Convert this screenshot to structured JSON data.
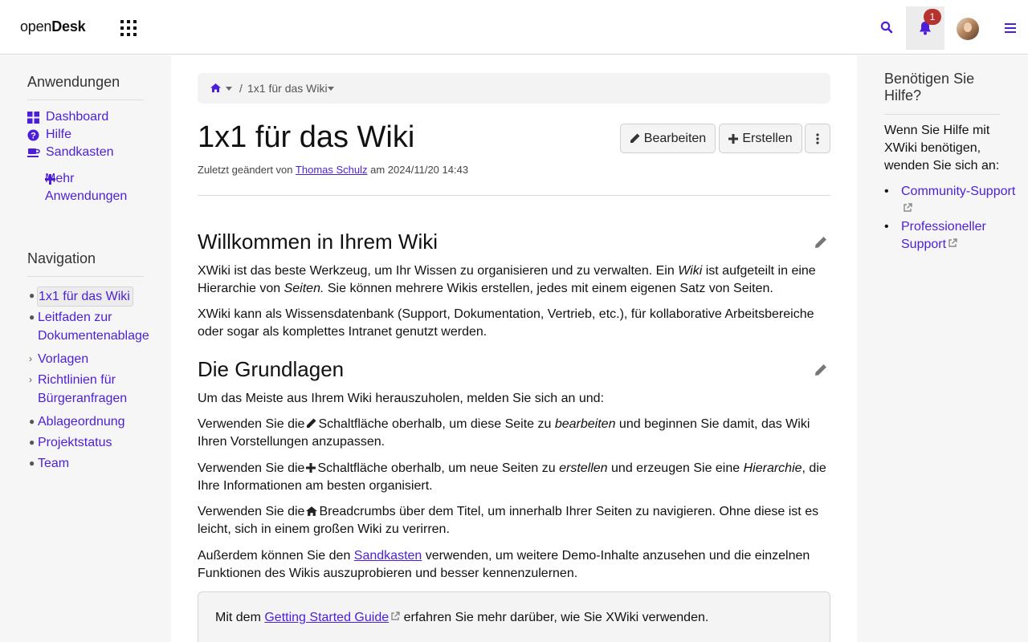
{
  "topbar": {
    "logo_prefix": "open",
    "logo_bold": "Desk",
    "notification_count": "1",
    "accent_color": "#4c1ed8",
    "badge_color": "#b5322f"
  },
  "left": {
    "apps_heading": "Anwendungen",
    "apps": [
      {
        "label": "Dashboard",
        "icon": "dashboard-icon"
      },
      {
        "label": "Hilfe",
        "icon": "question-circle-icon"
      },
      {
        "label": "Sandkasten",
        "icon": "coffee-icon"
      }
    ],
    "more_apps_line1": "Mehr",
    "more_apps_line2": "Anwendungen",
    "nav_heading": "Navigation",
    "nav": [
      {
        "line1": "1x1 für das Wiki",
        "line2": ""
      },
      {
        "line1": "Leitfaden zur",
        "line2": "Dokumentenablage"
      },
      {
        "line1": "Vorlagen",
        "line2": ""
      },
      {
        "line1": "Richtlinien für",
        "line2": "Bürgeranfragen"
      },
      {
        "line1": "Ablageordnung",
        "line2": ""
      },
      {
        "line1": "Projektstatus",
        "line2": ""
      },
      {
        "line1": "Team",
        "line2": ""
      }
    ]
  },
  "main": {
    "breadcrumb_sep": "/",
    "breadcrumb_page": "1x1 für das Wiki",
    "title": "1x1 für das Wiki",
    "edit_label": "Bearbeiten",
    "create_label": "Erstellen",
    "modified_prefix": "Zuletzt geändert von",
    "modified_author": "Thomas Schulz",
    "modified_suffix": "am 2024/11/20 14:43",
    "section1_title": "Willkommen in Ihrem Wiki",
    "s1_p1_a": "XWiki ist das beste Werkzeug, um Ihr Wissen zu organisieren und zu verwalten. Ein",
    "s1_p1_em1": "Wiki",
    "s1_p1_b": "ist aufgeteilt in eine Hierarchie von",
    "s1_p1_em2": "Seiten.",
    "s1_p1_c": "Sie können mehrere Wikis erstellen, jedes mit einem eigenen Satz von Seiten.",
    "s1_p2": "XWiki kann als Wissensdatenbank (Support, Dokumentation, Vertrieb, etc.), für kollaborative Arbeitsbereiche oder sogar als komplettes Intranet genutzt werden.",
    "section2_title": "Die Grundlagen",
    "s2_p1": "Um das Meiste aus Ihrem Wiki herauszuholen, melden Sie sich an und:",
    "s2_p2_a": "Verwenden Sie die",
    "s2_p2_b": "Schaltfläche oberhalb, um diese Seite zu",
    "s2_p2_em": "bearbeiten",
    "s2_p2_c": "und beginnen Sie damit, das Wiki Ihren Vorstellungen anzupassen.",
    "s2_p3_a": "Verwenden Sie die",
    "s2_p3_b": "Schaltfläche oberhalb, um neue Seiten zu",
    "s2_p3_em1": "erstellen",
    "s2_p3_c": "und erzeugen Sie eine",
    "s2_p3_em2": "Hierarchie",
    "s2_p3_d": ", die Ihre Informationen am besten organisiert.",
    "s2_p4_a": "Verwenden Sie die",
    "s2_p4_b": "Breadcrumbs über dem Titel, um innerhalb Ihrer Seiten zu navigieren. Ohne diese ist es leicht, sich in einem großen Wiki zu verirren.",
    "s2_p5_a": "Außerdem können Sie den",
    "s2_p5_link": "Sandkasten",
    "s2_p5_b": "verwenden, um weitere Demo-Inhalte anzusehen und die einzelnen Funktionen des Wikis auszuprobieren und besser kennenzulernen.",
    "info_a": "Mit dem",
    "info_link": "Getting Started Guide",
    "info_b": "erfahren Sie mehr darüber, wie Sie XWiki verwenden."
  },
  "right": {
    "heading": "Benötigen Sie Hilfe?",
    "text": "Wenn Sie Hilfe mit XWiki benötigen, wenden Sie sich an:",
    "links": [
      "Community-Support",
      "Professioneller Support"
    ],
    "bullet": "•"
  }
}
